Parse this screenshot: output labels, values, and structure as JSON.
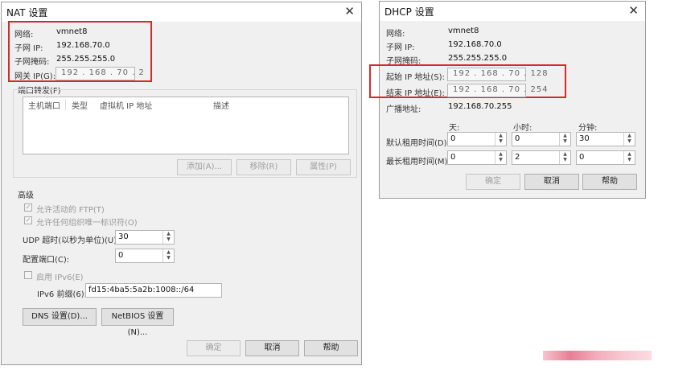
{
  "nat": {
    "title": "NAT 设置",
    "network_label": "网络:",
    "network_value": "vmnet8",
    "subnet_ip_label": "子网 IP:",
    "subnet_ip_value": "192.168.70.0",
    "subnet_mask_label": "子网掩码:",
    "subnet_mask_value": "255.255.255.0",
    "gateway_label": "网关 IP(G):",
    "gateway_value": "192 . 168 . 70 . 2",
    "port_forward_label": "端口转发(F)",
    "columns": [
      "主机端口",
      "类型",
      "虚拟机 IP 地址",
      "描述"
    ],
    "add_button": "添加(A)...",
    "remove_button": "移除(R)",
    "properties_button": "属性(P)",
    "advanced_label": "高级",
    "allow_ftp": "允许活动的 FTP(T)",
    "allow_oui": "允许任何组织唯一标识符(O)",
    "udp_timeout_label": "UDP 超时(以秒为单位)(U):",
    "udp_timeout_value": "30",
    "config_port_label": "配置端口(C):",
    "config_port_value": "0",
    "enable_ipv6": "启用 IPv6(E)",
    "ipv6_prefix_label": "IPv6 前缀(6):",
    "ipv6_prefix_value": "fd15:4ba5:5a2b:1008::/64",
    "dns_button": "DNS 设置(D)...",
    "netbios_button": "NetBIOS 设置(N)...",
    "ok_button": "确定",
    "cancel_button": "取消",
    "help_button": "帮助"
  },
  "dhcp": {
    "title": "DHCP 设置",
    "network_label": "网络:",
    "network_value": "vmnet8",
    "subnet_ip_label": "子网 IP:",
    "subnet_ip_value": "192.168.70.0",
    "subnet_mask_label": "子网掩码:",
    "subnet_mask_value": "255.255.255.0",
    "start_ip_label": "起始 IP 地址(S):",
    "start_ip_value": "192 . 168 . 70 . 128",
    "end_ip_label": "结束 IP 地址(E):",
    "end_ip_value": "192 . 168 . 70 . 254",
    "broadcast_label": "广播地址:",
    "broadcast_value": "192.168.70.255",
    "day_header": "天:",
    "hour_header": "小时:",
    "minute_header": "分钟:",
    "default_lease_label": "默认租用时间(D):",
    "default_lease": {
      "days": "0",
      "hours": "0",
      "minutes": "30"
    },
    "max_lease_label": "最长租用时间(M):",
    "max_lease": {
      "days": "0",
      "hours": "2",
      "minutes": "0"
    },
    "ok_button": "确定",
    "cancel_button": "取消",
    "help_button": "帮助"
  },
  "colors": {
    "highlight_box": "#d62a2a",
    "dialog_bg": "#f0f0f0",
    "watermark": "#f2a9b8"
  },
  "icons": {
    "close": "close-icon",
    "spin": "spin-arrows-icon",
    "check": "checkbox-checked-icon"
  }
}
